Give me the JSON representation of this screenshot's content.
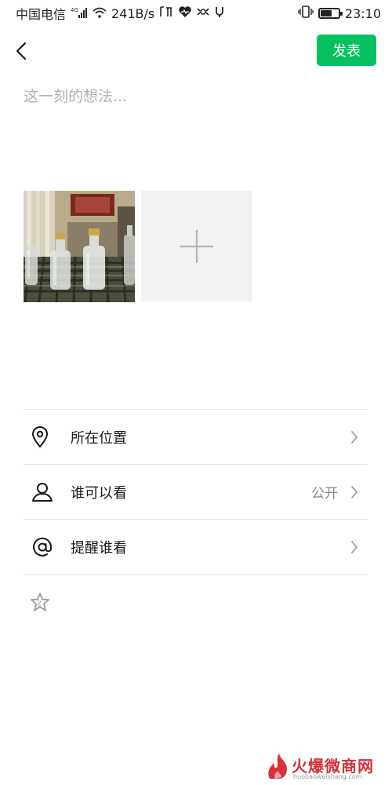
{
  "status_bar": {
    "carrier": "中国电信",
    "network_badge": "4G",
    "speed": "241B/s",
    "time": "23:10",
    "battery_level": 0.65
  },
  "nav": {
    "publish_label": "发表"
  },
  "composer": {
    "placeholder": "这一刻的想法..."
  },
  "media": {
    "photos": [
      {
        "subject": "glass liquor bottles on a checkered tablecloth"
      }
    ]
  },
  "options": [
    {
      "icon": "location-pin-icon",
      "label": "所在位置",
      "value": ""
    },
    {
      "icon": "person-icon",
      "label": "谁可以看",
      "value": "公开"
    },
    {
      "icon": "at-icon",
      "label": "提醒谁看",
      "value": ""
    }
  ],
  "extra": {
    "icon": "star-badge-icon"
  },
  "watermark": {
    "logo_text": "火爆微商网",
    "url": "huobaoweishang.com"
  },
  "colors": {
    "accent": "#07c160",
    "divider": "#e6e6e6",
    "placeholder": "#b2b2b2",
    "secondary_text": "#888888"
  }
}
